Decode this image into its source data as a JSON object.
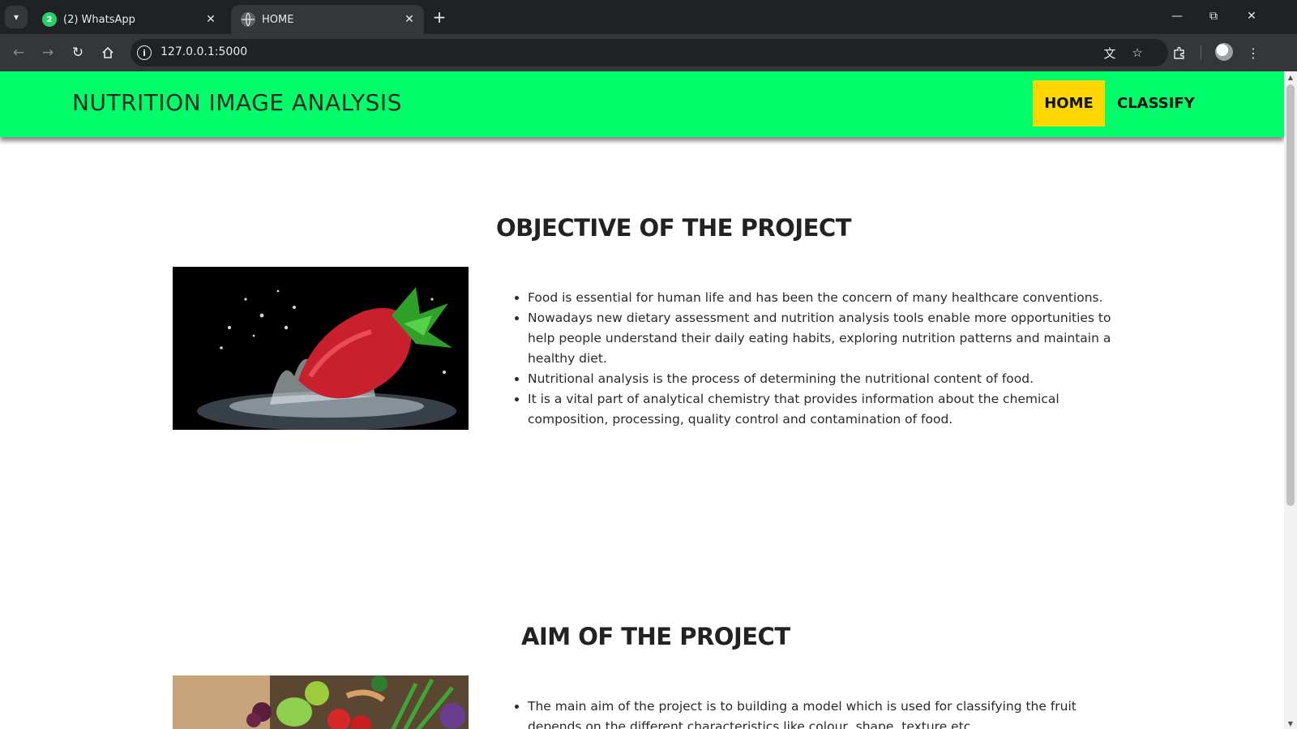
{
  "browser": {
    "tabs": [
      {
        "title": "(2) WhatsApp",
        "badge": "2",
        "active": false
      },
      {
        "title": "HOME",
        "active": true
      }
    ],
    "new_tab_label": "+",
    "url": "127.0.0.1:5000"
  },
  "site": {
    "title": "NUTRITION IMAGE ANALYSIS",
    "nav": [
      {
        "label": "HOME",
        "active": true
      },
      {
        "label": "CLASSIFY",
        "active": false
      }
    ],
    "colors": {
      "header": "#00fe6b",
      "active_nav": "#ffd700"
    }
  },
  "sections": [
    {
      "heading": "OBJECTIVE OF THE PROJECT",
      "image_icon": "strawberry-splash-image",
      "bullets": [
        "Food is essential for human life and has been the concern of many healthcare conventions.",
        "Nowadays new dietary assessment and nutrition analysis tools enable more opportunities to help people understand their daily eating habits, exploring nutrition patterns and maintain a healthy diet.",
        "Nutritional analysis is the process of determining the nutritional content of food.",
        "It is a vital part of analytical chemistry that provides information about the chemical composition, processing, quality control and contamination of food."
      ]
    },
    {
      "heading": "AIM OF THE PROJECT",
      "image_icon": "vegetables-image",
      "bullets": [
        "The main aim of the project is to building a model which is used for classifying the fruit depends on the different characteristics like colour, shape, texture etc."
      ]
    }
  ]
}
